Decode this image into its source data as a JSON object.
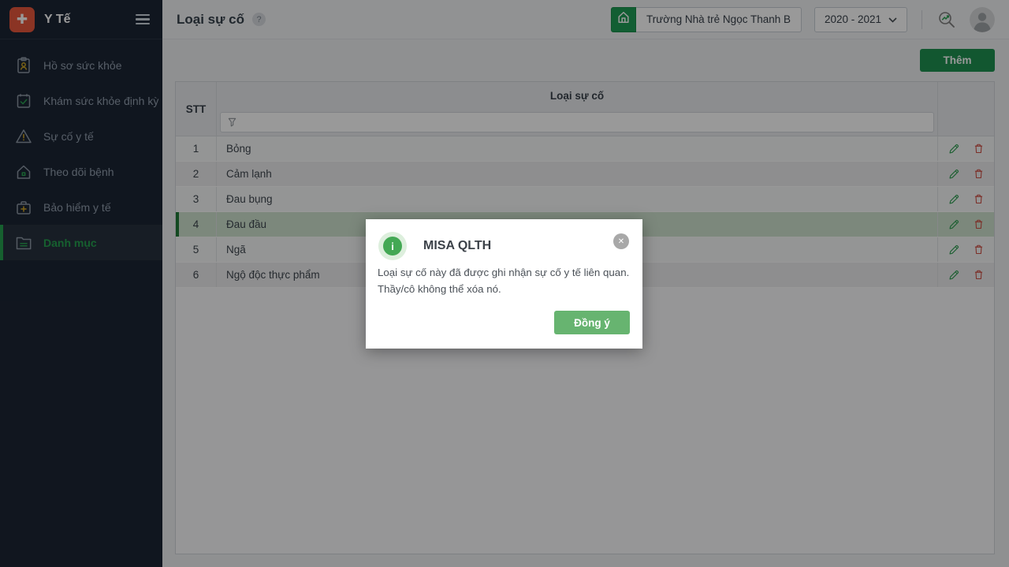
{
  "app": {
    "name": "Y Tế",
    "logo_glyph": "✚"
  },
  "sidebar": {
    "items": [
      {
        "label": "Hồ sơ sức khỏe",
        "icon": "clipboard-person-icon",
        "active": false
      },
      {
        "label": "Khám sức khỏe định kỳ",
        "icon": "calendar-check-icon",
        "active": false
      },
      {
        "label": "Sự cố y tế",
        "icon": "warning-triangle-icon",
        "active": false
      },
      {
        "label": "Theo dõi bệnh",
        "icon": "house-icon",
        "active": false
      },
      {
        "label": "Bảo hiểm y tế",
        "icon": "medical-bag-icon",
        "active": false
      },
      {
        "label": "Danh mục",
        "icon": "folder-icon",
        "active": true
      }
    ]
  },
  "header": {
    "title": "Loại sự cố",
    "help_glyph": "?",
    "school": "Trường Nhà trẻ Ngọc Thanh B",
    "school_year": "2020 - 2021"
  },
  "toolbar": {
    "add_label": "Thêm"
  },
  "table": {
    "columns": {
      "stt": "STT",
      "name": "Loại sự cố"
    },
    "filter_value": "",
    "rows": [
      {
        "stt": "1",
        "name": "Bỏng",
        "selected": false
      },
      {
        "stt": "2",
        "name": "Cảm lạnh",
        "selected": false
      },
      {
        "stt": "3",
        "name": "Đau bụng",
        "selected": false
      },
      {
        "stt": "4",
        "name": "Đau đầu",
        "selected": true
      },
      {
        "stt": "5",
        "name": "Ngã",
        "selected": false
      },
      {
        "stt": "6",
        "name": "Ngộ độc thực phẩm",
        "selected": false
      }
    ]
  },
  "modal": {
    "title": "MISA QLTH",
    "info_glyph": "i",
    "close_glyph": "✕",
    "message_line1": "Loại sự cố này đã được ghi nhận sự cố y tế liên quan.",
    "message_line2": "Thầy/cô không thể xóa nó.",
    "confirm_label": "Đồng ý"
  },
  "colors": {
    "brand_red": "#e8573d",
    "accent_green": "#1e9150",
    "sidebar_bg": "#1c2534",
    "selected_row_green": "#cfe3cf",
    "edit_green": "#33a055",
    "delete_red": "#cf4f44",
    "modal_confirm_green": "#67b470"
  }
}
